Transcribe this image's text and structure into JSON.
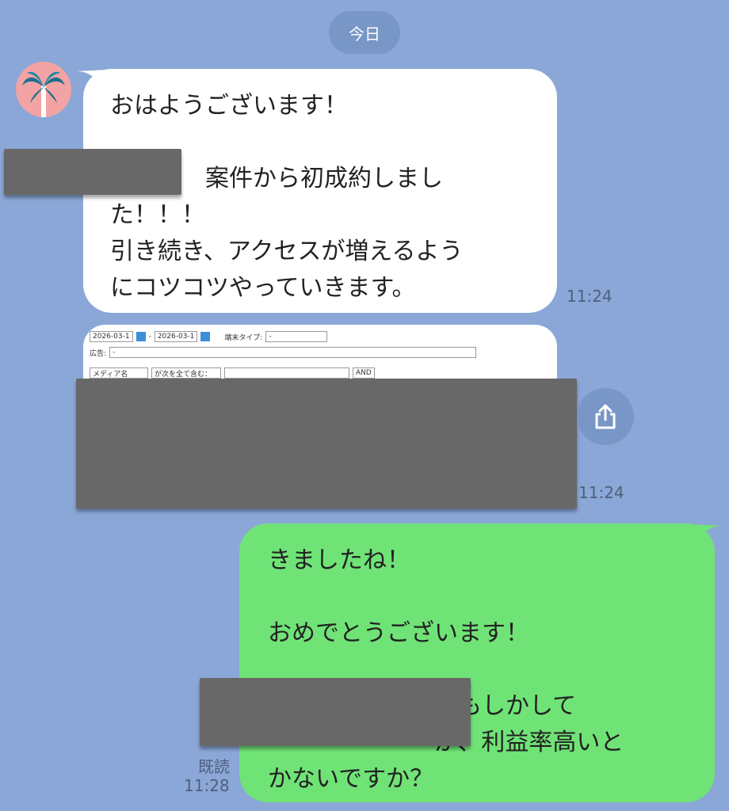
{
  "date_label": "今日",
  "incoming": {
    "lines": [
      "おはようございます！",
      "",
      "　　　　案件から初成約しまし",
      "た！！！",
      "引き続き、アクセスが増えるよう",
      "にコツコツやっていきます。"
    ],
    "time": "11:24"
  },
  "image_message": {
    "time": "11:24",
    "form": {
      "date_from": "2026-03-1",
      "date_to": "2026-03-1",
      "device_type_label": "端末タイプ:",
      "device_type_value": "-",
      "ad_label": "広告:",
      "ad_value": "-",
      "media_name": "メディア名",
      "contains_all": "が次を全て含む：",
      "logic": "AND"
    }
  },
  "outgoing": {
    "lines": [
      "きましたね！",
      "",
      "おめでとうございます！",
      "",
      "　　　　　　　　もしかして",
      "　　　　　　　が、利益率高いと",
      "かないですか？"
    ],
    "read_label": "既読",
    "time": "11:28"
  }
}
